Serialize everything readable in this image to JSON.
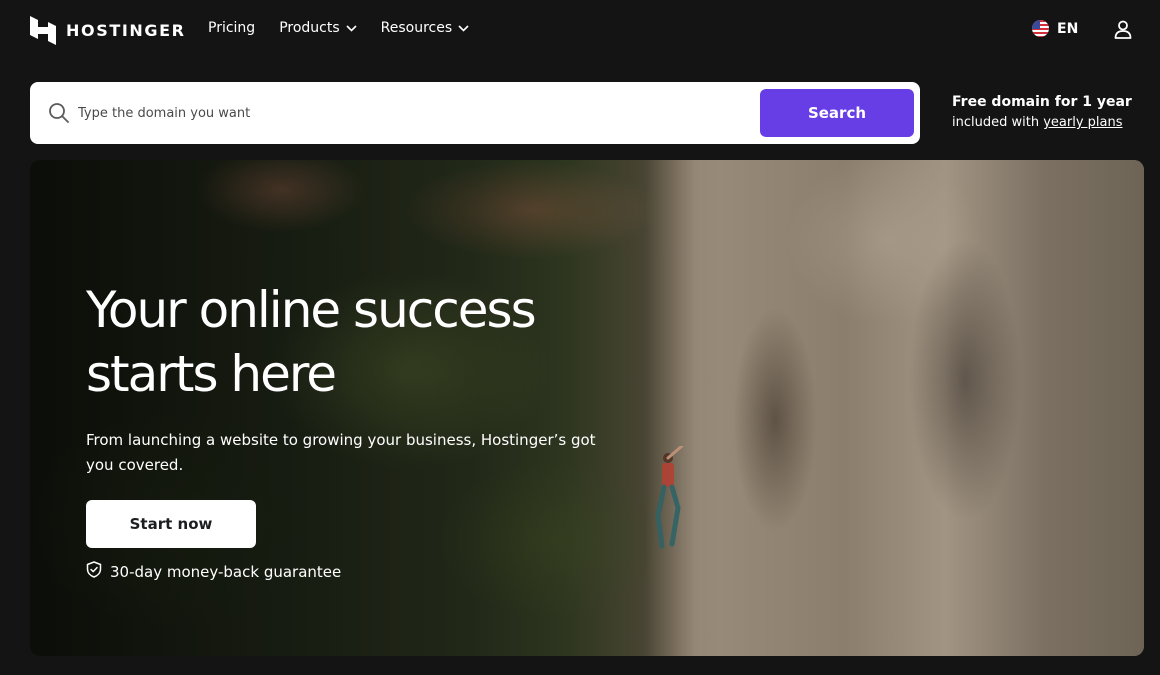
{
  "header": {
    "logo_text": "HOSTINGER",
    "logo_icon": "hostinger-logo-icon",
    "nav": [
      {
        "label": "Pricing",
        "has_dropdown": false
      },
      {
        "label": "Products",
        "has_dropdown": true
      },
      {
        "label": "Resources",
        "has_dropdown": true
      }
    ],
    "language": {
      "label": "EN",
      "flag_icon": "us-flag-icon"
    },
    "user_icon": "user-icon"
  },
  "search": {
    "placeholder": "Type the domain you want",
    "value": "",
    "button_label": "Search",
    "icon": "search-icon"
  },
  "promo": {
    "title": "Free domain for 1 year",
    "sub_prefix": "included with",
    "link_text": "yearly plans"
  },
  "hero": {
    "title_line1": "Your online success",
    "title_line2": "starts here",
    "subtitle": "From launching a website to growing your business, Hostinger’s got you covered.",
    "cta_label": "Start now",
    "guarantee_text": "30-day money-back guarantee",
    "guarantee_icon": "shield-check-icon"
  },
  "colors": {
    "background": "#141414",
    "accent": "#673de6",
    "text": "#ffffff"
  }
}
